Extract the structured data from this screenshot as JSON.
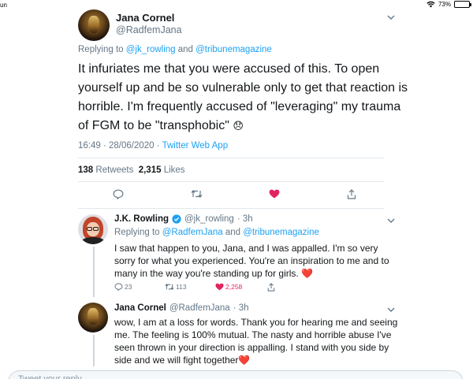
{
  "status_bar": {
    "carrier": "un",
    "battery": "73%"
  },
  "main_tweet": {
    "name": "Jana Cornel",
    "handle": "@RadfemJana",
    "replying_prefix": "Replying to ",
    "replying_user1": "@jk_rowling",
    "replying_and": " and ",
    "replying_user2": "@tribunemagazine",
    "text": "It infuriates me that you were accused of this. To open yourself up and be so vulnerable only to get that reaction is horrible. I'm frequently accused of \"leveraging\" my trauma of FGM to be \"transphobic\"",
    "emoji": "😞",
    "time": "16:49 · 28/06/2020 · ",
    "client": "Twitter Web App",
    "retweets_count": "138",
    "retweets_label": " Retweets",
    "likes_count": "2,315",
    "likes_label": " Likes"
  },
  "reply1": {
    "name": "J.K. Rowling",
    "handle": "@jk_rowling",
    "time": "· 3h",
    "replying_prefix": "Replying to ",
    "replying_user1": "@RadfemJana",
    "replying_and": " and ",
    "replying_user2": "@tribunemagazine",
    "text": "I saw that happen to you, Jana, and I was appalled. I'm so very sorry for what you experienced. You're an inspiration to me and to many in the way you're standing up for girls. ❤️",
    "reply_count": "23",
    "retweet_count": "113",
    "like_count": "2,258"
  },
  "reply2": {
    "name": "Jana Cornel",
    "handle": "@RadfemJana",
    "time": "· 3h",
    "text": "wow, I am at a loss for words. Thank you for hearing me and seeing me. The feeling is 100% mutual. The nasty and horrible abuse I've seen thrown in your direction is appalling.   I stand with you side by side and we will fight together❤️"
  },
  "composer": {
    "placeholder": "Tweet your reply"
  },
  "colors": {
    "accent": "#1da1f2",
    "like": "#e0245e",
    "muted": "#657786"
  }
}
